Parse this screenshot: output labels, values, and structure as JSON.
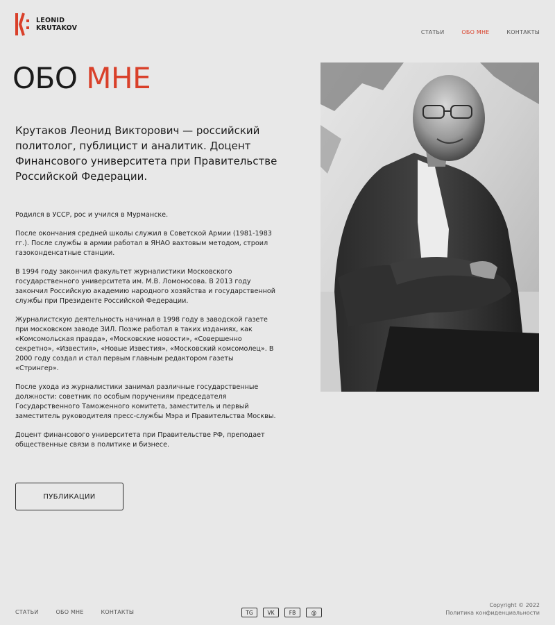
{
  "brand": {
    "line1": "LEONID",
    "line2": "KRUTAKOV",
    "accent_color": "#d9402a"
  },
  "nav": {
    "items": [
      {
        "label": "СТАТЬИ"
      },
      {
        "label": "ОБО МНЕ",
        "active": true
      },
      {
        "label": "КОНТАКТЫ"
      }
    ]
  },
  "hero": {
    "title_main": "ОБО ",
    "title_accent": "МНЕ",
    "lead": "Крутаков Леонид Викторович — российский политолог, публицист и аналитик. Доцент Финансового университета при Правительстве Российской Федерации."
  },
  "bio": [
    "Родился в УССР, рос и учился в Мурманске.",
    "После окончания средней школы служил в Советской Армии (1981-1983 гг.). После службы в армии работал в ЯНАО вахтовым методом, строил газоконденсатные станции.",
    "В 1994 году закончил факультет журналистики Московского государственного университета им. М.В. Ломоносова. В 2013 году закончил Российскую академию народного хозяйства и государственной службы при Президенте Российской Федерации.",
    "Журналистскую деятельность начинал в 1998 году в заводской газете при московском заводе ЗИЛ. Позже работал в таких изданиях, как «Комсомольская правда», «Московские новости», «Совершенно секретно», «Известия», «Новые Известия», «Московский комсомолец». В 2000 году создал и стал первым главным редактором газеты «Стрингер».",
    "После ухода из журналистики занимал различные государственные должности: советник по особым поручениям председателя Государственного Таможенного комитета, заместитель и первый заместитель руководителя пресс-службы Мэра и Правительства Москвы.",
    "Доцент финансового университета при Правительстве РФ, преподает общественные связи в политике и бизнесе."
  ],
  "cta": {
    "label": "ПУБЛИКАЦИИ"
  },
  "photo": {
    "icon": "portrait-photo"
  },
  "footer": {
    "nav": [
      {
        "label": "СТАТЬИ"
      },
      {
        "label": "ОБО МНЕ"
      },
      {
        "label": "КОНТАКТЫ"
      }
    ],
    "social": [
      {
        "label": "TG"
      },
      {
        "label": "VK"
      },
      {
        "label": "FB"
      },
      {
        "label": "@"
      }
    ],
    "copyright": "Copyright © 2022",
    "privacy": "Политика конфиденциальности"
  }
}
